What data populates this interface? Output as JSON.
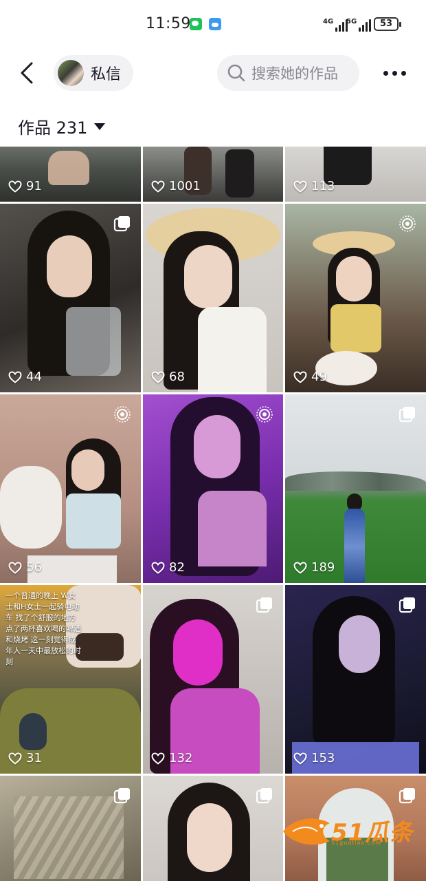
{
  "status_bar": {
    "time": "11:59",
    "net_a": "4G",
    "net_b": "5G",
    "battery": "53",
    "icons": [
      "wechat-icon",
      "weather-icon"
    ]
  },
  "header": {
    "back_icon": "chevron-left-icon",
    "dm_label": "私信",
    "search_placeholder": "搜索她的作品",
    "more_icon": "more-dots-icon"
  },
  "works": {
    "label": "作品 231"
  },
  "grid": {
    "tiles": [
      {
        "likes": "91",
        "badge": "",
        "caption": ""
      },
      {
        "likes": "1001",
        "badge": "",
        "caption": ""
      },
      {
        "likes": "113",
        "badge": "",
        "caption": ""
      },
      {
        "likes": "44",
        "badge": "gallery-icon",
        "caption": ""
      },
      {
        "likes": "68",
        "badge": "",
        "caption": ""
      },
      {
        "likes": "49",
        "badge": "live-icon",
        "caption": ""
      },
      {
        "likes": "56",
        "badge": "live-icon",
        "caption": ""
      },
      {
        "likes": "82",
        "badge": "live-icon",
        "caption": ""
      },
      {
        "likes": "189",
        "badge": "gallery-icon",
        "caption": ""
      },
      {
        "likes": "31",
        "badge": "",
        "caption": "一个普通的晚上 W女士和H女士一起骑电动车 找了个舒服的地方点了两杯喜欢喝的啤酒和烧烤 这一刻觉得成年人一天中最放松的时刻"
      },
      {
        "likes": "132",
        "badge": "gallery-icon",
        "caption": ""
      },
      {
        "likes": "153",
        "badge": "gallery-icon",
        "caption": ""
      },
      {
        "likes": "",
        "badge": "gallery-icon",
        "caption": ""
      },
      {
        "likes": "",
        "badge": "gallery-icon",
        "caption": ""
      },
      {
        "likes": "",
        "badge": "gallery-icon",
        "caption": ""
      }
    ]
  },
  "watermark": {
    "text": "51瓜条",
    "sub": "51guatiao.com"
  },
  "colors": {
    "background": "#ffffff",
    "pill": "#f2f2f4",
    "text_primary": "#161823",
    "text_secondary": "#8a8b91",
    "watermark": "#f28a1e"
  }
}
